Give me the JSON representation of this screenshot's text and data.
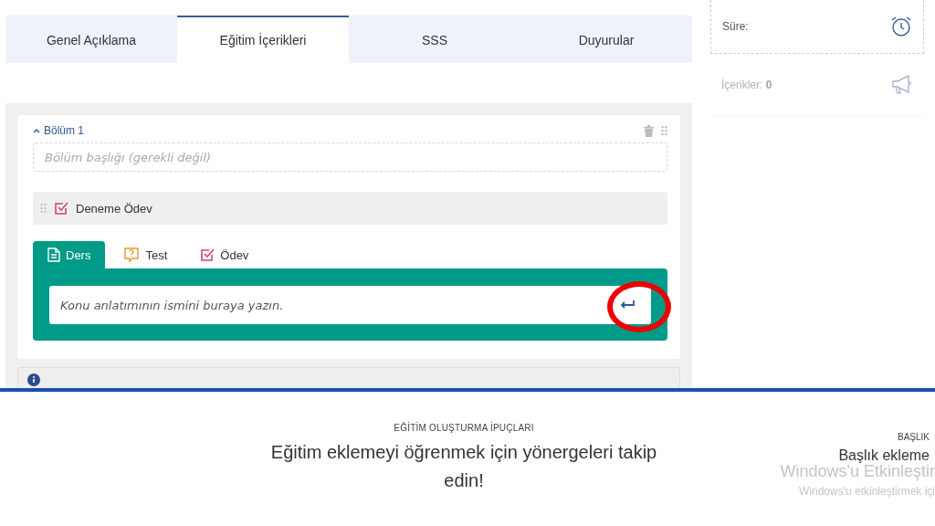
{
  "tabs": [
    {
      "label": "Genel Açıklama",
      "selected": false
    },
    {
      "label": "Eğitim İçerikleri",
      "selected": true
    },
    {
      "label": "SSS",
      "selected": false
    },
    {
      "label": "Duyurular",
      "selected": false
    }
  ],
  "sidebar": {
    "duration_label": "Süre:",
    "contents_label": "İçerikler:",
    "contents_count": "0"
  },
  "section": {
    "title": "Bölüm 1",
    "expanded": true,
    "title_field": {
      "placeholder": "Bölüm başlığı (gerekli değil)"
    },
    "items": [
      {
        "kind": "assignment",
        "title": "Deneme Ödev"
      }
    ],
    "content_tabs": [
      {
        "kind": "lesson",
        "label": "Ders",
        "selected": true
      },
      {
        "kind": "test",
        "label": "Test",
        "selected": false
      },
      {
        "kind": "assignment",
        "label": "Ödev",
        "selected": false
      }
    ],
    "name_field": {
      "value": "Konu anlatımının ismini buraya yazın."
    }
  },
  "tips": {
    "eyebrow": "EĞİTİM OLUŞTURMA İPUÇLARI",
    "heading": "Eğitim eklemeyi öğrenmek için yönergeleri takip edin!"
  },
  "title_panel": {
    "eyebrow": "BAŞLIK",
    "heading": "Başlık ekleme"
  },
  "os_watermark": {
    "title": "Windows'u Etkinleştir",
    "subtitle": "Windows'u etkinleştirmek içi"
  }
}
